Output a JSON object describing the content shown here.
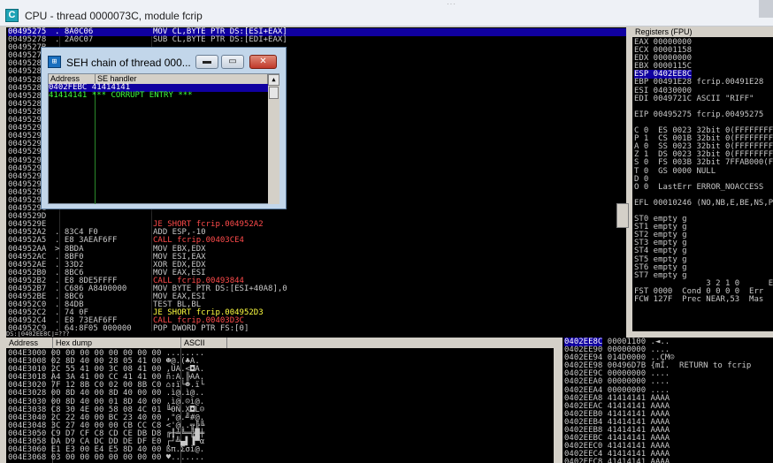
{
  "window": {
    "icon_letter": "C",
    "title": "CPU - thread 0000073C, module fcrip",
    "resize_grip": "···"
  },
  "disassembly": {
    "rows": [
      {
        "addr": "00495275",
        "hex": ". 8A0C06",
        "asm": "MOV CL,BYTE PTR DS:[ESI+EAX]",
        "kind": "sel"
      },
      {
        "addr": "00495278",
        "hex": ". 2A0C07",
        "asm": "SUB CL,BYTE PTR DS:[EDI+EAX]",
        "kind": "normal"
      },
      {
        "addr": "0049527B",
        "hex": "",
        "asm": "",
        "kind": "normal"
      },
      {
        "addr": "0049527E",
        "hex": "",
        "asm": "",
        "kind": "normal"
      },
      {
        "addr": "00495281",
        "hex": "",
        "asm": "",
        "kind": "normal"
      },
      {
        "addr": "00495283",
        "hex": "",
        "asm": "",
        "kind": "normal"
      },
      {
        "addr": "00495285",
        "hex": "",
        "asm": "",
        "kind": "normal"
      },
      {
        "addr": "00495288",
        "hex": "",
        "asm": "",
        "kind": "normal"
      },
      {
        "addr": "0049528A",
        "hex": "",
        "asm": "",
        "kind": "normal"
      },
      {
        "addr": "0049528D",
        "hex": "",
        "asm": "",
        "kind": "normal"
      },
      {
        "addr": "0049528F",
        "hex": "",
        "asm": "",
        "kind": "normal"
      },
      {
        "addr": "00495291",
        "hex": "",
        "asm": "",
        "kind": "normal"
      },
      {
        "addr": "00495292",
        "hex": "",
        "asm": "",
        "kind": "normal"
      },
      {
        "addr": "00495293",
        "hex": "",
        "asm": "",
        "kind": "normal"
      },
      {
        "addr": "00495294",
        "hex": "",
        "asm": "",
        "kind": "normal"
      },
      {
        "addr": "00495295",
        "hex": "",
        "asm": "",
        "kind": "normal"
      },
      {
        "addr": "00495296",
        "hex": "",
        "asm": "",
        "kind": "normal"
      },
      {
        "addr": "00495297",
        "hex": "",
        "asm": "",
        "kind": "normal"
      },
      {
        "addr": "00495298",
        "hex": "",
        "asm": "",
        "kind": "normal"
      },
      {
        "addr": "00495299",
        "hex": "",
        "asm": "",
        "kind": "normal"
      },
      {
        "addr": "0049529A",
        "hex": "",
        "asm": "",
        "kind": "normal"
      },
      {
        "addr": "0049529B",
        "hex": "",
        "asm": "",
        "kind": "normal"
      },
      {
        "addr": "0049529C",
        "hex": "",
        "asm": "",
        "kind": "normal"
      },
      {
        "addr": "0049529D",
        "hex": "",
        "asm": "",
        "kind": "normal"
      },
      {
        "addr": "0049529E",
        "hex": "",
        "asm": "",
        "kind": "normal"
      },
      {
        "addr": "004952A2",
        "hex": ". 83C4 F0",
        "asm": "ADD ESP,-10",
        "kind": "normal"
      },
      {
        "addr": "004952A5",
        "hex": ". E8 3AEAF6FF",
        "asm": "CALL fcrip.00403CE4",
        "kind": "call"
      },
      {
        "addr": "004952AA",
        "hex": "> 8BDA",
        "asm": "MOV EBX,EDX",
        "kind": "normal"
      },
      {
        "addr": "004952AC",
        "hex": ". 8BF0",
        "asm": "MOV ESI,EAX",
        "kind": "normal"
      },
      {
        "addr": "004952AE",
        "hex": ". 33D2",
        "asm": "XOR EDX,EDX",
        "kind": "normal"
      },
      {
        "addr": "004952B0",
        "hex": ". 8BC6",
        "asm": "MOV EAX,ESI",
        "kind": "normal"
      },
      {
        "addr": "004952B2",
        "hex": ". E8 8DE5FFFF",
        "asm": "CALL fcrip.00493844",
        "kind": "call"
      },
      {
        "addr": "004952B7",
        "hex": ". C686 A8400000",
        "asm": "MOV BYTE PTR DS:[ESI+40A8],0",
        "kind": "normal"
      },
      {
        "addr": "004952BE",
        "hex": ". 8BC6",
        "asm": "MOV EAX,ESI",
        "kind": "normal"
      },
      {
        "addr": "004952C0",
        "hex": ". 84DB",
        "asm": "TEST BL,BL",
        "kind": "normal"
      },
      {
        "addr": "004952C2",
        "hex": ". 74 0F",
        "asm": "JE SHORT fcrip.004952D3",
        "kind": "jmp"
      },
      {
        "addr": "004952C4",
        "hex": ". E8 73EAF6FF",
        "asm": "CALL fcrip.00403D3C",
        "kind": "call"
      },
      {
        "addr": "004952C9",
        "hex": ". 64:8F05 000000",
        "asm": "POP DWORD PTR FS:[0]",
        "kind": "normal"
      },
      {
        "addr": "004952D0",
        "hex": ". 83C4 0C",
        "asm": "ADD ESP,0C",
        "kind": "normal"
      },
      {
        "addr": "004952D3",
        "hex": "> 8BC6",
        "asm": "MOV EAX,ESI",
        "kind": "normal"
      }
    ],
    "partial_jmp_line": "JE SHORT fcrip.004952A2"
  },
  "info_bar": "DS:[0402EE8C]=???",
  "registers": {
    "header": "Registers (FPU)",
    "lines": [
      {
        "text": "EAX 00000000",
        "hl": false
      },
      {
        "text": "ECX 00001158",
        "hl": false
      },
      {
        "text": "EDX 00000000",
        "hl": false
      },
      {
        "text": "EBX 0000115C",
        "hl": false
      },
      {
        "text": "ESP 0402EE8C",
        "hl": true
      },
      {
        "text": "EBP 00491E28 fcrip.00491E28",
        "hl": false
      },
      {
        "text": "ESI 04030000",
        "hl": false
      },
      {
        "text": "EDI 0049721C ASCII \"RIFF\"",
        "hl": false
      },
      {
        "text": "",
        "hl": false
      },
      {
        "text": "EIP 00495275 fcrip.00495275",
        "hl": false
      },
      {
        "text": "",
        "hl": false
      },
      {
        "text": "C 0  ES 0023 32bit 0(FFFFFFFF)",
        "hl": false
      },
      {
        "text": "P 1  CS 001B 32bit 0(FFFFFFFF)",
        "hl": false
      },
      {
        "text": "A 0  SS 0023 32bit 0(FFFFFFFF)",
        "hl": false
      },
      {
        "text": "Z 1  DS 0023 32bit 0(FFFFFFFF)",
        "hl": false
      },
      {
        "text": "S 0  FS 003B 32bit 7FFAB000(FFF)",
        "hl": false
      },
      {
        "text": "T 0  GS 0000 NULL",
        "hl": false
      },
      {
        "text": "D 0",
        "hl": false
      },
      {
        "text": "O 0  LastErr ERROR_NOACCESS",
        "hl": false
      },
      {
        "text": "",
        "hl": false
      },
      {
        "text": "EFL 00010246 (NO,NB,E,BE,NS,PE)",
        "hl": false
      },
      {
        "text": "",
        "hl": false
      },
      {
        "text": "ST0 empty g",
        "hl": false
      },
      {
        "text": "ST1 empty g",
        "hl": false
      },
      {
        "text": "ST2 empty g",
        "hl": false
      },
      {
        "text": "ST3 empty g",
        "hl": false
      },
      {
        "text": "ST4 empty g",
        "hl": false
      },
      {
        "text": "ST5 empty g",
        "hl": false
      },
      {
        "text": "ST6 empty g",
        "hl": false
      },
      {
        "text": "ST7 empty g",
        "hl": false
      },
      {
        "text": "               3 2 1 0      E",
        "hl": false
      },
      {
        "text": "FST 0000  Cond 0 0 0 0  Err",
        "hl": false
      },
      {
        "text": "FCW 127F  Prec NEAR,53  Mas",
        "hl": false
      }
    ]
  },
  "dump": {
    "col_address": "Address",
    "col_hex": "Hex dump",
    "col_ascii": "ASCII",
    "rows": [
      "004E3000 00 00 00 00 00 00 00 00 ........",
      "004E3008 02 8D 40 00 28 05 41 00 ☻@.(♣A.",
      "004E3010 2C 55 41 00 3C 08 41 00 ,UA.<◘A.",
      "004E3018 A4 3A 41 00 CC 41 41 00 ñ:A.╠AA.",
      "004E3020 7F 12 8B C0 02 00 8B C0 ⌂↕ï└☻.ï└",
      "004E3028 00 8D 40 00 8D 40 00 00 .ì@.ì@..",
      "004E3030 00 8D 40 00 01 8D 40 00 .ì@.☺ì@.",
      "004E3038 C8 30 4E 00 58 08 4C 01 ╚0N.X◘L☺",
      "004E3040 2C 22 40 00 BC 23 40 00 ,\"@.╝#@.",
      "004E3048 3C 27 40 00 00 CB CC C8 <'@..╦╠╚",
      "004E3050 C9 D7 CF C8 CD CE DB D8 ╔╫╧╚═╬█╪",
      "004E3058 DA D9 CA DC DD DE DF E0 ┌┘╩▄▌▐▀α",
      "004E3060 E1 E3 00 E4 E5 8D 40 00 ßπ.Σσì@.",
      "004E3068 03 00 00 00 00 00 00 00 ♥......."
    ]
  },
  "stack": {
    "rows": [
      {
        "addr": "0402EE8C",
        "val": "00001100",
        "note": ".◄..",
        "cur": true
      },
      {
        "addr": "0402EE90",
        "val": "00000000",
        "note": "....",
        "cur": false
      },
      {
        "addr": "0402EE94",
        "val": "014D0000",
        "note": "..ÇM☺",
        "cur": false
      },
      {
        "addr": "0402EE98",
        "val": "00496D7B",
        "note": "{mI.  RETURN to fcrip",
        "cur": false
      },
      {
        "addr": "0402EE9C",
        "val": "00000000",
        "note": "....",
        "cur": false
      },
      {
        "addr": "0402EEA0",
        "val": "00000000",
        "note": "....",
        "cur": false
      },
      {
        "addr": "0402EEA4",
        "val": "00000000",
        "note": "....",
        "cur": false
      },
      {
        "addr": "0402EEA8",
        "val": "41414141",
        "note": "AAAA",
        "cur": false
      },
      {
        "addr": "0402EEAC",
        "val": "41414141",
        "note": "AAAA",
        "cur": false
      },
      {
        "addr": "0402EEB0",
        "val": "41414141",
        "note": "AAAA",
        "cur": false
      },
      {
        "addr": "0402EEB4",
        "val": "41414141",
        "note": "AAAA",
        "cur": false
      },
      {
        "addr": "0402EEB8",
        "val": "41414141",
        "note": "AAAA",
        "cur": false
      },
      {
        "addr": "0402EEBC",
        "val": "41414141",
        "note": "AAAA",
        "cur": false
      },
      {
        "addr": "0402EEC0",
        "val": "41414141",
        "note": "AAAA",
        "cur": false
      },
      {
        "addr": "0402EEC4",
        "val": "41414141",
        "note": "AAAA",
        "cur": false
      },
      {
        "addr": "0402EEC8",
        "val": "41414141",
        "note": "AAAA",
        "cur": false
      }
    ]
  },
  "seh_window": {
    "icon": "⊞",
    "title": "SEH chain of thread 000...",
    "min_glyph": "▬",
    "max_glyph": "▭",
    "close_glyph": "✕",
    "col_address": "Address",
    "col_handler": "SE handler",
    "rows": [
      {
        "addr": "0402FEBC",
        "handler": "41414141",
        "sel": true
      },
      {
        "addr": "41414141",
        "handler": "*** CORRUPT ENTRY ***",
        "sel": false
      }
    ],
    "scroll_up_glyph": "▲"
  }
}
